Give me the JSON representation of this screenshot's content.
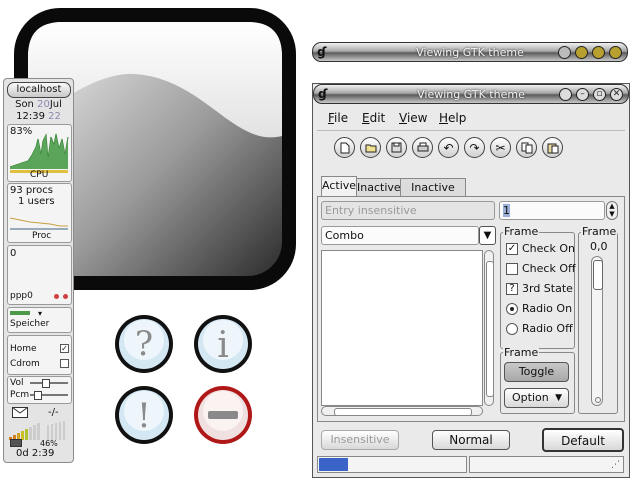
{
  "monitor": {
    "host": "localhost",
    "date": {
      "day": "Son",
      "num": "20",
      "month": "Jul"
    },
    "time": {
      "hm": "12:39",
      "sec": "22"
    },
    "cpu": {
      "percent": "83%",
      "label": "CPU"
    },
    "procs": {
      "count": "93 procs",
      "users": "1 users",
      "label": "Proc"
    },
    "net": {
      "value": "0",
      "label": "ppp0"
    },
    "mem": {
      "label": "Speicher"
    },
    "disks": [
      {
        "label": "Home"
      },
      {
        "label": "Cdrom"
      }
    ],
    "mixer": [
      {
        "label": "Vol"
      },
      {
        "label": "Pcm"
      }
    ],
    "mail": {
      "count": "-/-"
    },
    "battery": {
      "percent": "46%",
      "remaining": "0d  2:39"
    }
  },
  "small_window": {
    "title": "Viewing GTK theme"
  },
  "window": {
    "title": "Viewing GTK theme",
    "menu": [
      {
        "key": "F",
        "rest": "ile"
      },
      {
        "key": "E",
        "rest": "dit"
      },
      {
        "key": "V",
        "rest": "iew"
      },
      {
        "key": "H",
        "rest": "elp"
      }
    ],
    "toolbar_icons": [
      "new-icon",
      "open-icon",
      "save-icon",
      "print-icon",
      "undo-icon",
      "redo-icon",
      "cut-icon",
      "copy-icon",
      "paste-icon"
    ],
    "tabs": [
      "Active",
      "Inactive",
      "Inactive too"
    ],
    "entry_insensitive": "Entry insensitive",
    "spin_value": "1",
    "combo_value": "Combo",
    "frame_label": "Frame",
    "options": [
      {
        "label": "Check On",
        "type": "check",
        "checked": true
      },
      {
        "label": "Check Off",
        "type": "check",
        "checked": false
      },
      {
        "label": "3rd State",
        "type": "check",
        "checked": null
      },
      {
        "label": "Radio On",
        "type": "radio",
        "checked": true
      },
      {
        "label": "Radio Off",
        "type": "radio",
        "checked": false
      }
    ],
    "toggle_label": "Toggle",
    "option_label": "Option",
    "scale_frame_label": "Frame",
    "scale_value": "0,0",
    "buttons": {
      "insensitive": "Insensitive",
      "normal": "Normal",
      "default": "Default"
    },
    "progress": 0.2
  }
}
